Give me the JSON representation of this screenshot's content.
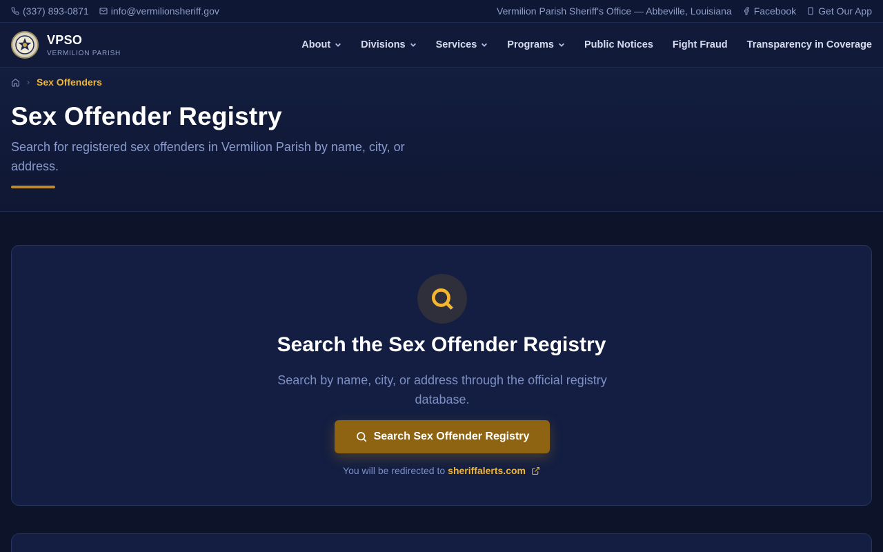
{
  "topbar": {
    "phone": "(337) 893-0871",
    "email": "info@vermilionsheriff.gov",
    "office": "Vermilion Parish Sheriff's Office — Abbeville, Louisiana",
    "facebook": "Facebook",
    "app": "Get Our App"
  },
  "brand": {
    "name": "VPSO",
    "subtitle": "VERMILION PARISH"
  },
  "nav": {
    "about": "About",
    "divisions": "Divisions",
    "services": "Services",
    "programs": "Programs",
    "public_notices": "Public Notices",
    "fight_fraud": "Fight Fraud",
    "transparency": "Transparency in Coverage"
  },
  "breadcrumb": {
    "current": "Sex Offenders"
  },
  "hero": {
    "title": "Sex Offender Registry",
    "lead": "Search for registered sex offenders in Vermilion Parish by name, city, or address."
  },
  "card": {
    "title": "Search the Sex Offender Registry",
    "description": "Search by name, city, or address through the official registry database.",
    "button": "Search Sex Offender Registry",
    "redirect_text": "You will be redirected to",
    "redirect_link": "sheriffalerts.com"
  },
  "colors": {
    "accent": "#f2b631",
    "button": "#8e6412",
    "background": "#0d1429"
  },
  "icons": [
    "phone-icon",
    "mail-icon",
    "facebook-icon",
    "smartphone-icon",
    "chevron-down-icon",
    "home-icon",
    "search-icon",
    "external-link-icon"
  ]
}
